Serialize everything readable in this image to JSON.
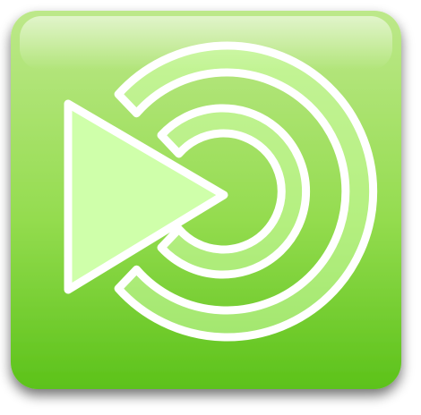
{
  "icon": {
    "name": "mate-desktop-logo-icon",
    "colors": {
      "tile_light": "#bde88a",
      "tile_mid": "#94dc4f",
      "tile_dark": "#5cc21a",
      "arc_fill": "#cfffaa",
      "outline": "#ffffff",
      "shadow": "#000000"
    }
  }
}
